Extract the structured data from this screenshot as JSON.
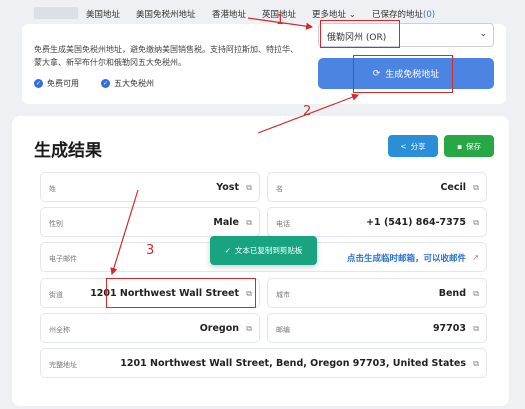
{
  "nav": {
    "items": [
      "美国地址",
      "美国免税州地址",
      "香港地址",
      "英国地址",
      "更多地址 ⌄"
    ],
    "saved_label": "已保存的地址",
    "saved_count": "(0)"
  },
  "hero": {
    "description": "免费生成美国免税州地址，避免缴纳美国销售税。支持阿拉斯加、特拉华、蒙大拿、新罕布什尔和俄勒冈五大免税州。",
    "features": [
      "免费可用",
      "五大免税州"
    ],
    "state_select_value": "俄勒冈州 (OR)",
    "generate_label": "生成免税地址"
  },
  "result": {
    "title": "生成结果",
    "share_label": "分享",
    "save_label": "保存",
    "fields": {
      "last_name": {
        "label": "姓",
        "value": "Yost"
      },
      "first_name": {
        "label": "名",
        "value": "Cecil"
      },
      "gender": {
        "label": "性别",
        "value": "Male"
      },
      "phone": {
        "label": "电话",
        "value": "+1 (541) 864-7375"
      },
      "email": {
        "label": "电子邮件",
        "value": "点击生成临时邮箱，可以收邮件"
      },
      "street": {
        "label": "街道",
        "value": "1201 Northwest Wall Street"
      },
      "city": {
        "label": "城市",
        "value": "Bend"
      },
      "state": {
        "label": "州全称",
        "value": "Oregon"
      },
      "zip": {
        "label": "邮编",
        "value": "97703"
      },
      "full": {
        "label": "完整地址",
        "value": "1201 Northwest Wall Street, Bend, Oregon 97703, United States"
      }
    }
  },
  "toast": {
    "text": "文本已复制到剪贴板"
  },
  "annotations": {
    "steps": [
      "1",
      "2",
      "3"
    ],
    "color": "#d62a2a"
  }
}
